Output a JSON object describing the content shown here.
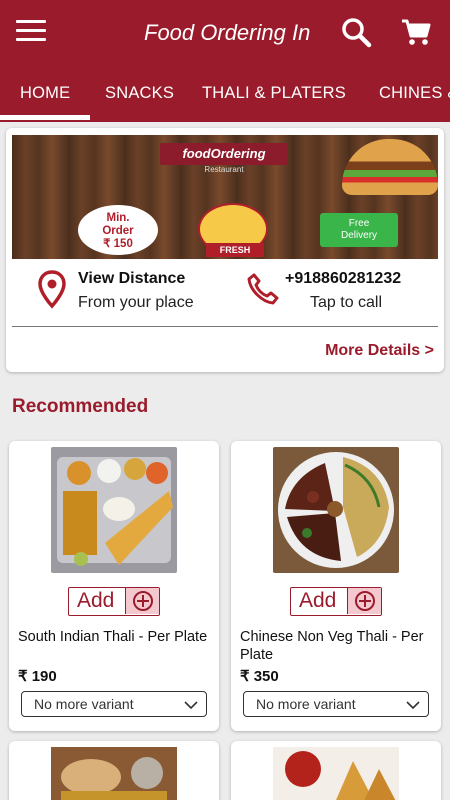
{
  "app": {
    "title": "Food Ordering In"
  },
  "tabs": [
    "HOME",
    "SNACKS",
    "THALI & PLATERS",
    "CHINES &"
  ],
  "banner": {
    "logo_text": "foodOrdering",
    "logo_sub": "Restaurant",
    "min_order": [
      "Min.",
      "Order",
      "₹ 150"
    ],
    "fresh_label": "FRESH",
    "delivery_label": [
      "Free",
      "Delivery"
    ]
  },
  "info": {
    "distance_title": "View Distance",
    "distance_sub": "From your place",
    "phone": "+918860281232",
    "phone_sub": "Tap to call",
    "more": "More Details >"
  },
  "section": {
    "title": "Recommended"
  },
  "products": [
    {
      "name": "South Indian Thali - Per Plate",
      "price": "₹ 190",
      "add": "Add",
      "variant": "No more variant"
    },
    {
      "name": "Chinese Non Veg Thali - Per Plate",
      "price": "₹ 350",
      "add": "Add",
      "variant": "No more variant"
    }
  ],
  "colors": {
    "primary": "#9a1c2c",
    "add_bg": "#f3c9cf",
    "background": "#ececec"
  },
  "icons": [
    "menu-icon",
    "search-icon",
    "cart-icon",
    "location-pin-icon",
    "phone-icon",
    "plus-circle-icon",
    "chevron-down-icon"
  ]
}
